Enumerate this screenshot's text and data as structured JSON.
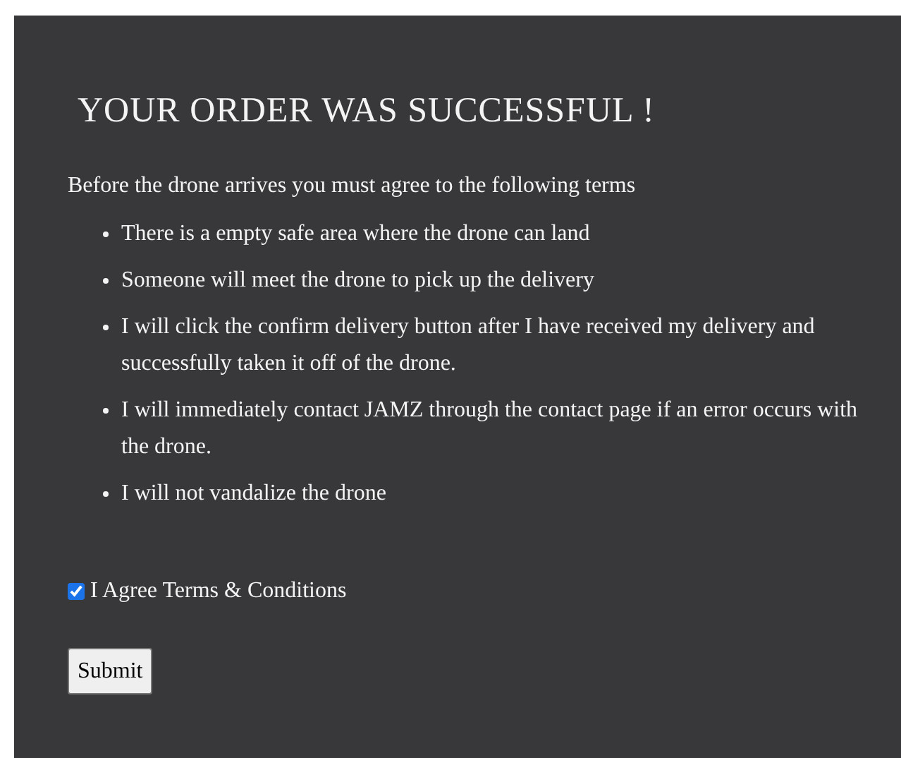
{
  "heading": "YOUR ORDER WAS SUCCESSFUL !",
  "intro": "Before the drone arrives you must agree to the following terms",
  "terms": [
    "There is a empty safe area where the drone can land",
    "Someone will meet the drone to pick up the delivery",
    "I will click the confirm delivery button after I have received my delivery and successfully taken it off of the drone.",
    "I will immediately contact JAMZ through the contact page if an error occurs with the drone.",
    "I will not vandalize the drone"
  ],
  "agreement": {
    "label": "I Agree Terms & Conditions",
    "checked": true
  },
  "submit_button": "Submit"
}
